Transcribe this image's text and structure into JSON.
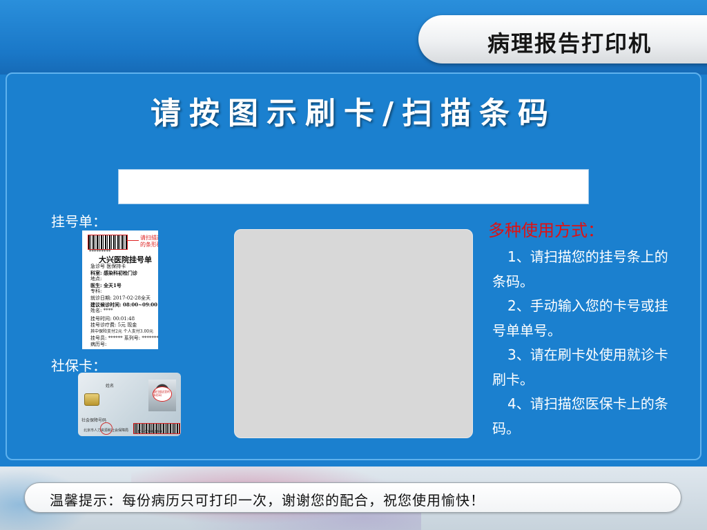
{
  "header": {
    "title": "病理报告打印机"
  },
  "main": {
    "headline": "请按图示刷卡/扫描条码",
    "input": {
      "value": "",
      "placeholder": ""
    },
    "registration_label": "挂号单：",
    "social_card_label": "社保卡：",
    "slip": {
      "stars": "*********",
      "note_line1": "请扫描这里",
      "note_line2": "的条形码",
      "hospital": "大兴医院挂号单",
      "lines": [
        "急诊号              医保持卡",
        "科室: 感染科初检门诊",
        "地点:",
        "医生:                  全天1号",
        "专科:",
        "就诊日期: 2017-02-28全天",
        "建议候诊时间: 08:00~09:00 上午",
        "姓名: ****",
        "挂号时间: 00:01:48",
        "挂号诊疗费:    5元     现金",
        "其中保险支付2元    个人支付3.00元",
        "挂号员: ******  系列号: *******",
        "病历号:"
      ]
    },
    "card": {
      "name_label": "姓名",
      "photo_note": "请扫描这里的条形码",
      "number_label": "社会保障号码",
      "issuer": "北京市人力资源和社会保障局",
      "barcode_number": "10000001000"
    }
  },
  "usage": {
    "title": "多种使用方式：",
    "items": [
      "1、请扫描您的挂号条上的条码。",
      "2、手动输入您的卡号或挂号单单号。",
      "3、请在刷卡处使用就诊卡刷卡。",
      "4、请扫描您医保卡上的条码。"
    ]
  },
  "footer": {
    "tip": "温馨提示：每份病历只可打印一次，谢谢您的配合，祝您使用愉快！"
  },
  "colors": {
    "background": "#1b80cf",
    "usage_title": "#e01010",
    "scan_area": "#d8d8d8"
  }
}
